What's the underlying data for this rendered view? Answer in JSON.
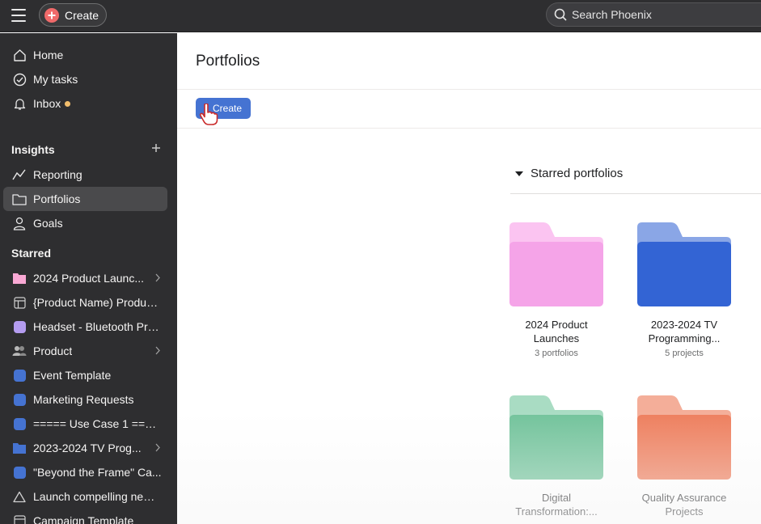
{
  "topbar": {
    "menu_icon": "hamburger-menu-icon",
    "create_label": "Create",
    "search_placeholder": "Search Phoenix"
  },
  "sidebar": {
    "nav": [
      {
        "label": "Home",
        "icon": "home-icon"
      },
      {
        "label": "My tasks",
        "icon": "check-circle-icon"
      },
      {
        "label": "Inbox",
        "icon": "bell-icon",
        "dot_color": "#f1bd6c"
      }
    ],
    "insights": {
      "title": "Insights",
      "items": [
        {
          "label": "Reporting",
          "icon": "line-chart-icon"
        },
        {
          "label": "Portfolios",
          "icon": "folder-icon",
          "active": true
        },
        {
          "label": "Goals",
          "icon": "person-icon"
        }
      ]
    },
    "starred": {
      "title": "Starred",
      "items": [
        {
          "label": "2024 Product Launc...",
          "icon": "folder-icon",
          "color": "#f9a8d4"
        },
        {
          "label": "{Product Name) Product...",
          "icon": "board-icon"
        },
        {
          "label": "Headset - Bluetooth Pro...",
          "icon": "project-square-icon",
          "color": "#b49cf0"
        },
        {
          "label": "Product",
          "icon": "team-icon"
        },
        {
          "label": "Event Template",
          "icon": "project-square-icon",
          "color": "#4573d2"
        },
        {
          "label": "Marketing Requests",
          "icon": "project-square-icon",
          "color": "#4573d2"
        },
        {
          "label": "===== Use Case 1 ====...",
          "icon": "project-square-icon",
          "color": "#4573d2"
        },
        {
          "label": "2023-2024 TV Prog...",
          "icon": "folder-icon",
          "color": "#4573d2"
        },
        {
          "label": "\"Beyond the Frame\" Ca...",
          "icon": "project-square-icon",
          "color": "#4573d2"
        },
        {
          "label": "Launch compelling new ...",
          "icon": "goal-triangle-icon"
        },
        {
          "label": "Campaign Template",
          "icon": "board-icon"
        }
      ]
    }
  },
  "main": {
    "title": "Portfolios",
    "create_label": "Create",
    "starred_section_title": "Starred portfolios",
    "portfolios": [
      {
        "name_line1": "2024 Product",
        "name_line2": "Launches",
        "meta": "3 portfolios",
        "color": "#f5a4e8",
        "tab_color": "#fbc4f1"
      },
      {
        "name_line1": "2023-2024 TV",
        "name_line2": "Programming...",
        "meta": "5 projects",
        "color": "#3364d4",
        "tab_color": "#8aa6e6"
      },
      {
        "name_line1": "Digital",
        "name_line2": "Transformation:...",
        "meta": "",
        "color": "#72c39b",
        "tab_color": "#a9dcc3"
      },
      {
        "name_line1": "Quality Assurance",
        "name_line2": "Projects",
        "meta": "",
        "color": "#ee7e5d",
        "tab_color": "#f4ae99"
      }
    ]
  },
  "colors": {
    "sidebar_bg": "#2e2e30",
    "accent_blue": "#4573d2",
    "create_red": "#f06a6a"
  }
}
